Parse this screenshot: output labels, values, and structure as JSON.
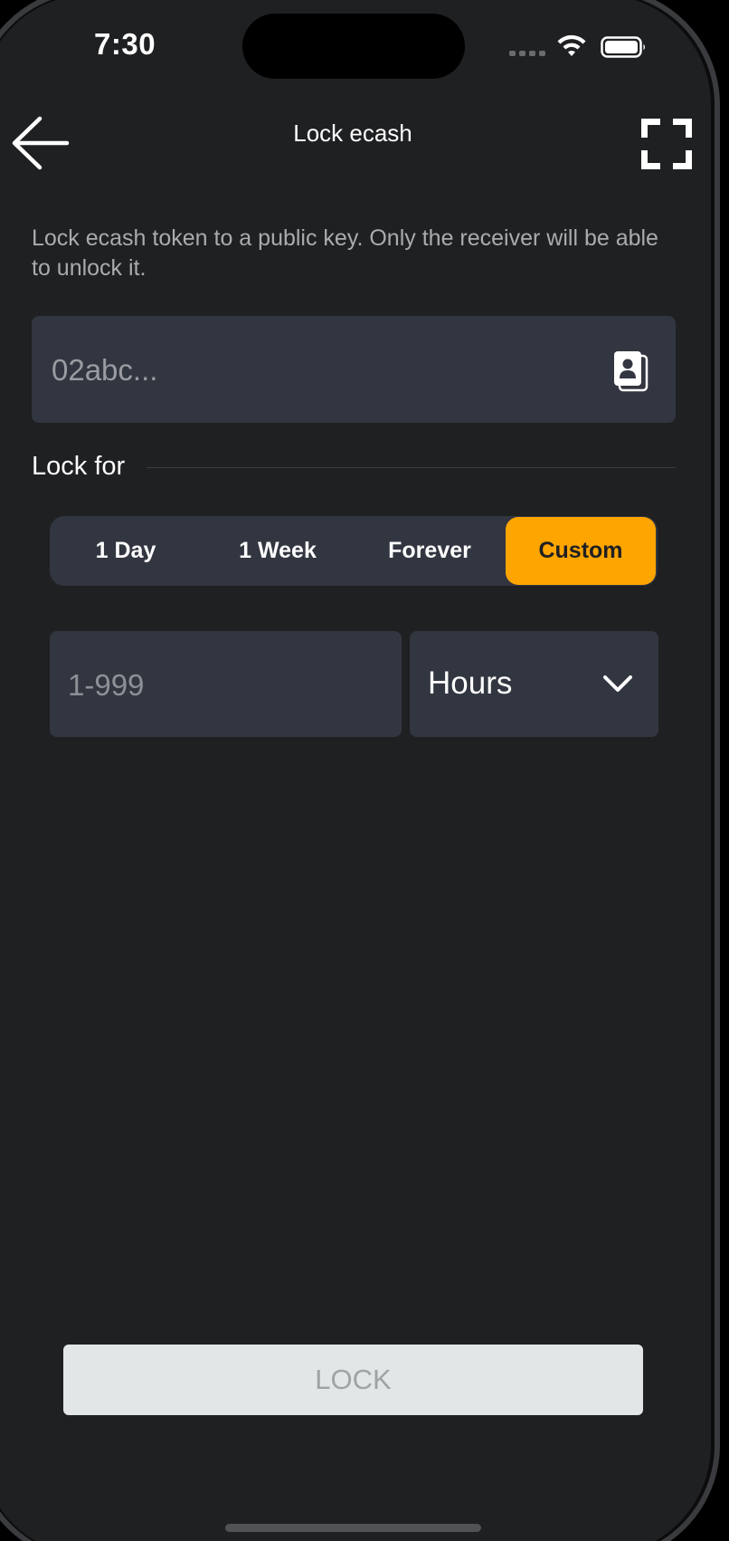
{
  "status_bar": {
    "time": "7:30",
    "wifi_icon": "wifi-icon",
    "battery_icon": "battery-icon"
  },
  "header": {
    "title": "Lock ecash",
    "back_icon": "arrow-left-icon",
    "scan_icon": "scan-frame-icon"
  },
  "description": "Lock ecash token to a public key. Only the receiver will be able to unlock it.",
  "pubkey": {
    "placeholder": "02abc...",
    "value": "",
    "contacts_icon": "contacts-icon"
  },
  "lock_for": {
    "label": "Lock for",
    "options": [
      {
        "label": "1 Day",
        "selected": false
      },
      {
        "label": "1 Week",
        "selected": false
      },
      {
        "label": "Forever",
        "selected": false
      },
      {
        "label": "Custom",
        "selected": true
      }
    ]
  },
  "duration": {
    "placeholder": "1-999",
    "value": "",
    "unit": "Hours",
    "chevron_icon": "chevron-down-icon"
  },
  "lock_button": {
    "label": "LOCK",
    "enabled": false
  },
  "colors": {
    "background": "#1f2022",
    "field": "#323640",
    "accent": "#ffa500",
    "button_disabled_bg": "#e2e6e6",
    "button_disabled_text": "#9fa3a5"
  }
}
